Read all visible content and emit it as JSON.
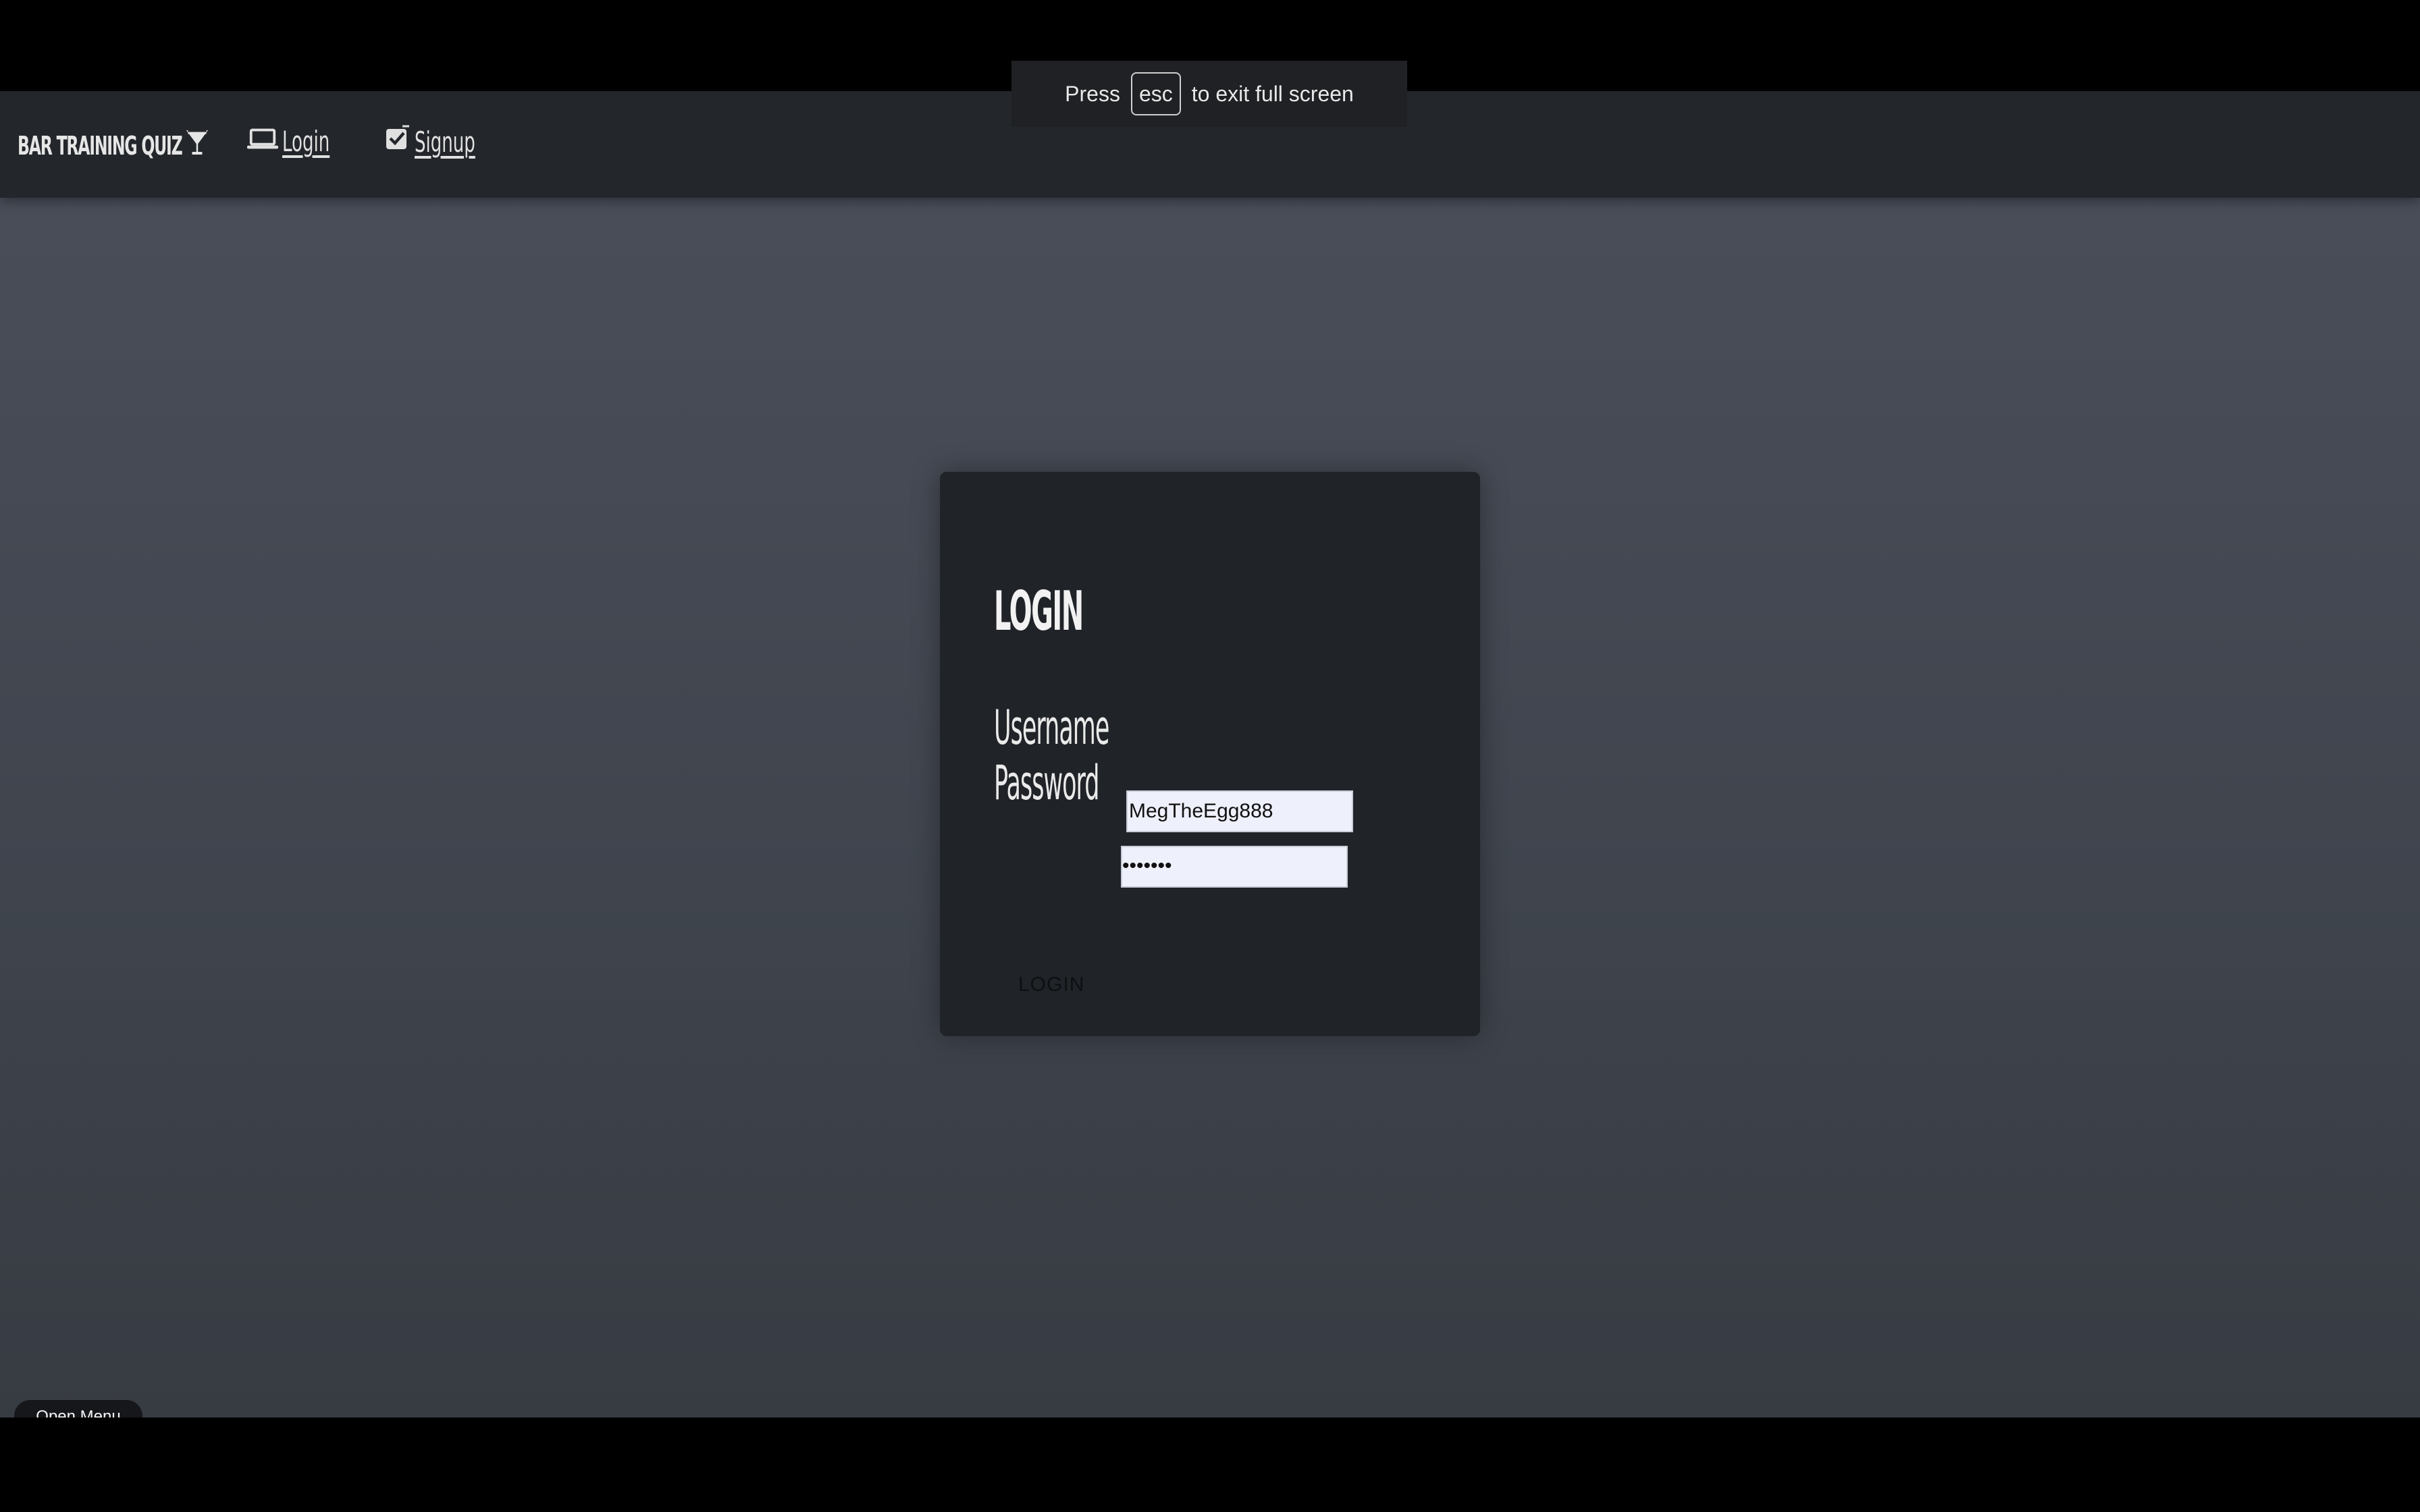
{
  "fullscreen_notice": {
    "prefix": "Press",
    "key": "esc",
    "suffix": "to exit full screen"
  },
  "navbar": {
    "brand": "BAR TRAINING QUIZ",
    "brand_icon": "cocktail-glass-icon",
    "links": [
      {
        "label": "Login",
        "icon": "laptop-icon"
      },
      {
        "label": "Signup",
        "icon": "checkbox-icon"
      }
    ]
  },
  "login_card": {
    "title": "LOGIN",
    "username_label": "Username",
    "username_value": "MegTheEgg888",
    "password_label": "Password",
    "password_value": "•••••••",
    "submit_label": "LOGIN"
  },
  "widgets": {
    "open_menu_label": "Open Menu",
    "more_label": "···"
  },
  "colors": {
    "page_bg_top": "#4b4f5a",
    "page_bg_bottom": "#373b42",
    "navbar_bg": "#23262b",
    "card_bg": "#202328",
    "input_bg": "#eef0fb"
  }
}
